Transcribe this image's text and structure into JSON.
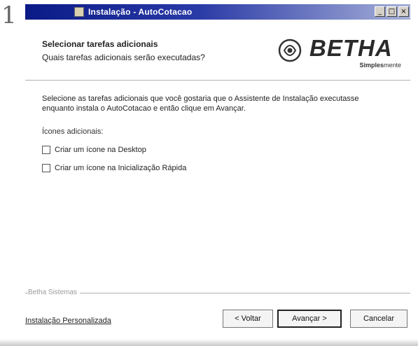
{
  "window": {
    "title": "Instalação - AutoCotacao",
    "buttons": {
      "minimize": "_",
      "maximize": "□",
      "close": "×"
    }
  },
  "header": {
    "title": "Selecionar tarefas adicionais",
    "subtitle": "Quais tarefas adicionais serão executadas?"
  },
  "logo": {
    "brand": "BETHA",
    "tagline_bold": "Simples",
    "tagline_light": "mente"
  },
  "body": {
    "description": "Selecione as tarefas adicionais que você gostaria que o Assistente de Instalação executasse enquanto instala o AutoCotacao e então clique em Avançar.",
    "group_label": "Ícones adicionais:",
    "tasks": [
      {
        "label": "Criar um ícone na Desktop",
        "checked": false
      },
      {
        "label": "Criar um ícone na Inicialização Rápida",
        "checked": false
      }
    ]
  },
  "footer": {
    "brand": "Betha Sistemas",
    "help_link": "Instalação Personalizada",
    "back_label": "< Voltar",
    "next_label": "Avançar >",
    "cancel_label": "Cancelar"
  },
  "colors": {
    "titlebar_start": "#0a1a86",
    "titlebar_end": "#a6b0d8",
    "logo_text": "#2a2a2a"
  },
  "icons": {
    "logo_mark": "betha-logo-icon",
    "app_icon": "installer-app-icon"
  }
}
